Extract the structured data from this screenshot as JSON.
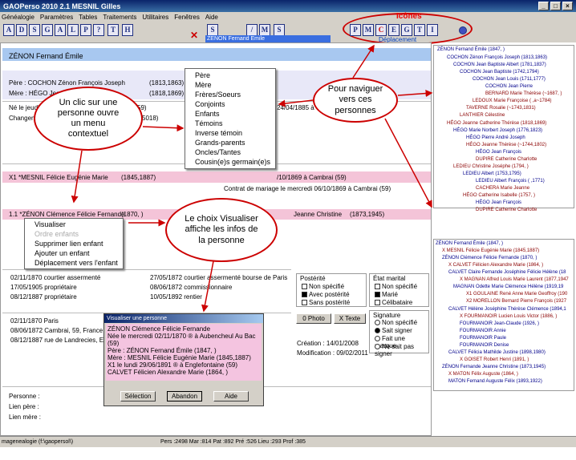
{
  "app": {
    "title": "GAOPerso 2010   2.1     MESNIL Gilles"
  },
  "menu": [
    "Généalogie",
    "Paramètres",
    "Tables",
    "Traitements",
    "Utilitaires",
    "Fenêtres",
    "Aide"
  ],
  "toolbar": {
    "icons_label": "Icônes",
    "nav_label": "Déplacement",
    "current_person": "ZENON Fernand Emile"
  },
  "main": {
    "header": "ZÉNON Fernand Émile",
    "father": "Père :  COCHON Zénon François Joseph",
    "father_dates": "(1813,1863)",
    "mother": "Mère :  HÉGO Jeanne",
    "mother_dates": "(1818,1869)",
    "birth": "Né le jeudi 20",
    "birth_end": "59)",
    "birth_right": "24/04/1885 à Ca",
    "change": "Changement",
    "change_end": "5018)",
    "spouse": "X1 *MESNIL Félicie Eugénie Marie",
    "spouse_dates": "(1845,1887)",
    "spouse_right": "/10/1869 à Cambrai (59)",
    "contract": "Contrat de mariage le mercredi 06/10/1869 à Cambrai (59)",
    "child": "1.1 *ZÉNON Clémence Félicie Fernande",
    "child_dates": "(1870,    )",
    "child_right": "Jeanne Christine",
    "child_right_dates": "(1873,1945)",
    "jobs_left": [
      "02/11/1870 courtier assermenté",
      "17/05/1905 propriétaire",
      "08/12/1887 propriétaire"
    ],
    "jobs_right": [
      "27/05/1872 courtier assermenté bourse de Paris",
      "08/06/1872 commissionnaire",
      "10/05/1892 rentier"
    ],
    "addr_left": [
      "02/11/1870 Paris",
      "08/06/1872 Cambrai, 59, France",
      "08/12/1887 rue de Landrecies, Eng"
    ],
    "person_lbl": "Personne :",
    "father_link": "Lien père :",
    "mother_link": "Lien mère :"
  },
  "right_panel": {
    "posterity_title": "Postérité",
    "posterity": [
      "Non spécifié",
      "Avec postérité",
      "Sans postérité"
    ],
    "marital_title": "État marital",
    "marital": [
      "Non spécifié",
      "Marié",
      "Célibataire"
    ],
    "photo_btn": "0 Photo",
    "text_btn": "X Texte",
    "signature_title": "Signature",
    "signature": [
      "Non spécifié",
      "Sait signer",
      "Fait une marque",
      "Ne sait pas signer"
    ],
    "created": "Création : 14/01/2008",
    "modified": "Modification : 09/02/2011"
  },
  "context_menu": [
    "Père",
    "Mère",
    "Frères/Soeurs",
    "Conjoints",
    "Enfants",
    "Témoins",
    "Inverse témoin",
    "Grands-parents",
    "Oncles/Tantes",
    "Cousin(e)s germain(e)s"
  ],
  "child_menu": [
    "Visualiser",
    "Ordre enfants",
    "Supprimer lien enfant",
    "Ajouter un enfant",
    "Déplacement vers l'enfant"
  ],
  "bubbles": {
    "click": "Un clic sur une personne ouvre un menu contextuel",
    "nav": "Pour naviguer vers ces personnes",
    "view": "Le choix Visualiser affiche les infos de la personne"
  },
  "dialog": {
    "title": "Visualiser une personne",
    "lines": [
      "ZÉNON Clémence Félicie Fernande",
      "Née le mercredi 02/11/1870 ® à Aubencheul Au Bac (59)",
      "Père : ZÉNON Fernand Émile    (1847,   )",
      "Mère : MESNIL Félicie Eugénie Marie    (1845,1887)",
      "X1 le lundi 29/06/1891 ® à Englefontaine (59)",
      "   CALVET Félicien Alexandre Marie    (1864,   )"
    ],
    "select": "Sélection",
    "cancel": "Abandon",
    "help": "Aide"
  },
  "tree_top": [
    "ZÉNON Fernand Émile   (1847,   )",
    "COCHON Zénon François Joseph   (1813,1863)",
    "COCHON Jean Baptiste Albert   (1781,1837)",
    "COCHON Jean Baptiste   (1742,1794)",
    "COCHON Jean Louis   (1711,1777)",
    "COCHON Jean Pierre",
    "BERNARD Marie Thérèse   (~1687,   )",
    "LEDOUX Marie Françoise   (   ,a~1784)",
    "TAVERNE Rosalie   (~1743,1831)",
    "LANTHIER Célestine",
    "HÉGO Jeanne Catherine Thérèse   (1818,1869)",
    "HÉGO Marie Norbert Joseph   (1776,1823)",
    "HÉGO Pierre André Joseph",
    "HÉGO Jeanne Thérèse   (~1744,1802)",
    "HÉGO Jean François",
    "DUPIRE Catherine Charlotte",
    "LEDIEU Christine Joséphe   (1794,   )",
    "LEDIEU Albert   (1753,1795)",
    "LEDIEU Albert François   (   ,1771)",
    "CACHERA Marie Jeanne",
    "HÉGO Catherine Isabelle   (1757,   )",
    "HÉGO Jean François",
    "DUPIRE Catherine Charlotte"
  ],
  "tree_bottom": [
    "ZÉNON Fernand Émile   (1847,   )",
    "X MESNIL Félicie Eugénie Marie   (1845,1887)",
    "ZÉNON Clémence Félicie Fernande   (1870,   )",
    "X CALVET Félicien Alexandre Marie   (1864,   )",
    "CALVET Claire Fernande Joséphine Félicie Hélène   (18",
    "X MAGNAN Alfred Louis Marie Laurent   (1877,1947",
    "MAGNAN Odette Marie Clémence Hélène   (1919,19",
    "X1 GOULAINE René Anne Marie Geoffroy   (190",
    "X2 MORELLON Bernard Pierre François   (1927",
    "CALVET Hélène Joséphine Thérèse Clémence   (1894,1",
    "X FOURMANOIR Lucien Louis Victor   (1886,   )",
    "FOURMANOIR Jean-Claude   (1926,   )",
    "FOURMANOIR Annie",
    "FOURMANOIR Paule",
    "FOURMANOIR Denise",
    "CALVET Félicia Mathilde Justine   (1898,1980)",
    "X GOISET Robert Henri   (1891,   )",
    "ZÉNON Fernande Jeanne Christine   (1873,1945)",
    "X MATON Félix Auguste   (1864,   )",
    "MATON Fernand Auguste Félix   (1893,1922)"
  ],
  "status": {
    "left": "magenealogie (f:\\gaopersol\\)",
    "right": "Pers :2498 Mar :814 Pat :892 Pré :526 Lieu :293 Prof :385"
  }
}
